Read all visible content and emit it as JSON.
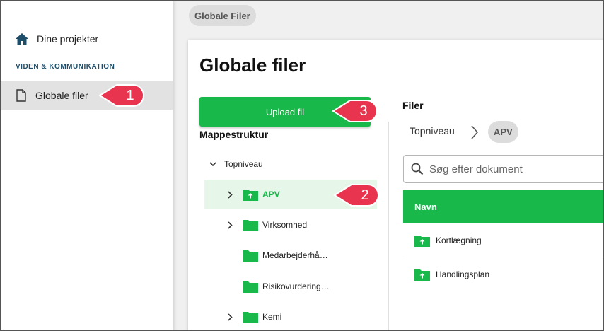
{
  "sidebar": {
    "items": [
      {
        "label": "Dine projekter",
        "icon": "home-icon"
      },
      {
        "label": "Globale filer",
        "icon": "document-icon"
      }
    ],
    "section_label": "VIDEN & KOMMUNIKATION"
  },
  "header": {
    "breadcrumb": "Globale Filer"
  },
  "main": {
    "title": "Globale filer",
    "upload_label": "Upload fil",
    "tree": {
      "title": "Mappestruktur",
      "root": "Topniveau",
      "folders": [
        {
          "label": "APV",
          "expandable": true,
          "selected": true,
          "upload_icon": true
        },
        {
          "label": "Virksomhed",
          "expandable": true,
          "selected": false,
          "upload_icon": false
        },
        {
          "label": "Medarbejderhå…",
          "expandable": false,
          "selected": false,
          "upload_icon": false
        },
        {
          "label": "Risikovurdering…",
          "expandable": false,
          "selected": false,
          "upload_icon": false
        },
        {
          "label": "Kemi",
          "expandable": true,
          "selected": false,
          "upload_icon": false
        }
      ]
    },
    "files": {
      "title": "Filer",
      "breadcrumb_root": "Topniveau",
      "breadcrumb_current": "APV",
      "search_placeholder": "Søg efter dokument",
      "column_name": "Navn",
      "rows": [
        {
          "name": "Kortlægning"
        },
        {
          "name": "Handlingsplan"
        }
      ]
    }
  },
  "callouts": [
    "1",
    "2",
    "3"
  ],
  "colors": {
    "accent": "#19b84a",
    "callout": "#e8344e",
    "section": "#1f4e6a",
    "home_icon": "#1f4e6a"
  }
}
